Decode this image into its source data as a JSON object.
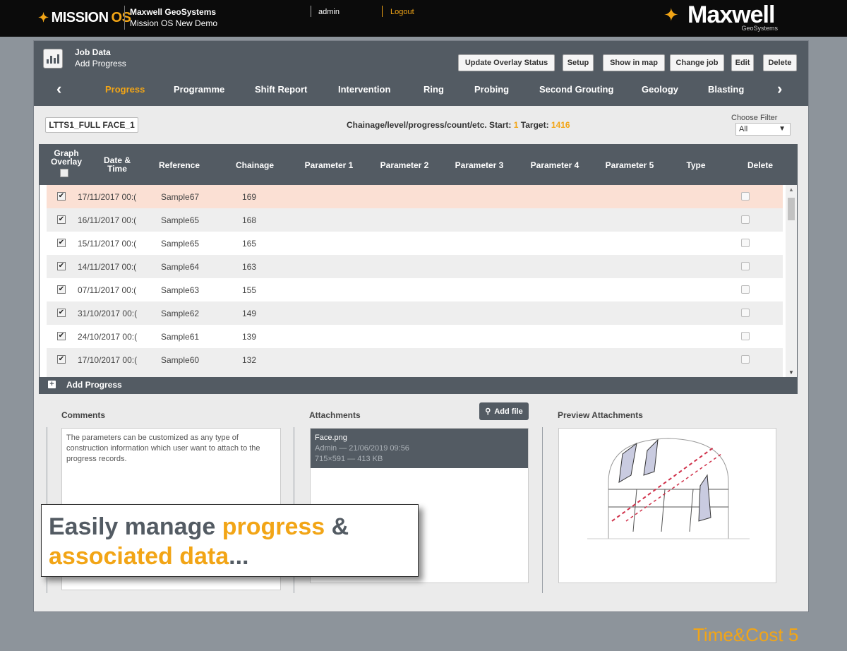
{
  "topbar": {
    "logo_text_a": "MISSION",
    "logo_text_b": "OS",
    "company": "Maxwell GeoSystems",
    "demo": "Mission OS New Demo",
    "user": "admin",
    "logout": "Logout",
    "brand_name": "Maxwell",
    "brand_sub": "GeoSystems"
  },
  "header": {
    "title": "Job Data",
    "subtitle": "Add Progress",
    "buttons": [
      "Update Overlay Status",
      "Setup",
      "Show in map",
      "Change job",
      "Edit",
      "Delete"
    ]
  },
  "tabs": [
    "Progress",
    "Programme",
    "Shift Report",
    "Intervention",
    "Ring",
    "Probing",
    "Second Grouting",
    "Geology",
    "Blasting"
  ],
  "filter": {
    "tag": "LTTS1_FULL FACE_1",
    "chainage_label": "Chainage/level/progress/count/etc. Start:",
    "start": "1",
    "target_label": "Target:",
    "target": "1416",
    "choose_label": "Choose Filter",
    "choose_value": "All"
  },
  "table": {
    "col_graph": "Graph Overlay",
    "col_date": "Date & Time",
    "columns": [
      "Reference",
      "Chainage",
      "Parameter 1",
      "Parameter 2",
      "Parameter 3",
      "Parameter 4",
      "Parameter 5",
      "Type",
      "Delete"
    ],
    "rows": [
      {
        "date": "17/11/2017 00:(",
        "ref": "Sample67",
        "ch": "169"
      },
      {
        "date": "16/11/2017 00:(",
        "ref": "Sample65",
        "ch": "168"
      },
      {
        "date": "15/11/2017 00:(",
        "ref": "Sample65",
        "ch": "165"
      },
      {
        "date": "14/11/2017 00:(",
        "ref": "Sample64",
        "ch": "163"
      },
      {
        "date": "07/11/2017 00:(",
        "ref": "Sample63",
        "ch": "155"
      },
      {
        "date": "31/10/2017 00:(",
        "ref": "Sample62",
        "ch": "149"
      },
      {
        "date": "24/10/2017 00:(",
        "ref": "Sample61",
        "ch": "139"
      },
      {
        "date": "17/10/2017 00:(",
        "ref": "Sample60",
        "ch": "132"
      }
    ],
    "add_label": "Add Progress"
  },
  "bottom": {
    "comments_title": "Comments",
    "comments_text": "The parameters can be customized as any type of construction information which user want to attach to the progress records.",
    "attachments_title": "Attachments",
    "add_file": "Add file",
    "file_name": "Face.png",
    "file_meta1": "Admin — 21/06/2019 09:56",
    "file_meta2": "715×591 — 413 KB",
    "preview_title": "Preview Attachments"
  },
  "callout": {
    "w1": "Easily manage ",
    "w2": "progress",
    "w3": " &",
    "w4": "associated data",
    "w5": "..."
  },
  "footer": "Time&Cost  5",
  "colors": {
    "accent": "#f2a516",
    "dark": "#535b63",
    "highlight": "#fbe0d4"
  }
}
